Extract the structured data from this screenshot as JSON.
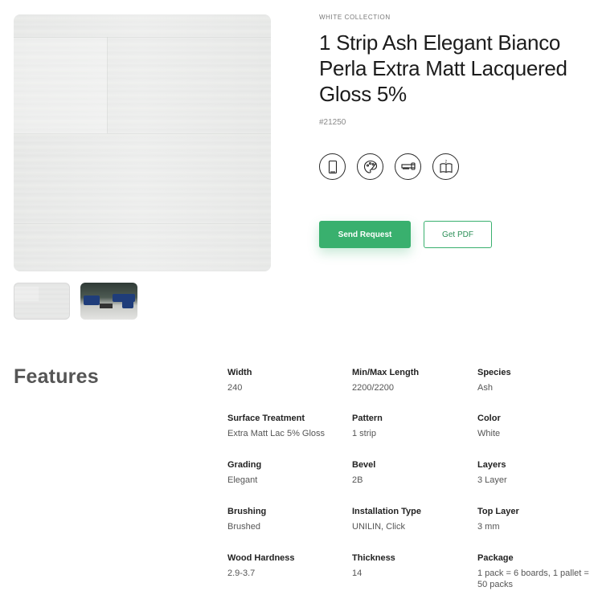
{
  "product": {
    "collection": "WHITE COLLECTION",
    "title": "1 Strip Ash Elegant Bianco Perla Extra Matt Lacquered Gloss 5%",
    "sku": "#21250"
  },
  "icons": [
    {
      "name": "door-icon"
    },
    {
      "name": "palette-icon"
    },
    {
      "name": "saw-icon"
    },
    {
      "name": "book-icon"
    }
  ],
  "actions": {
    "send_request": "Send Request",
    "get_pdf": "Get PDF"
  },
  "features": {
    "title": "Features",
    "items": [
      {
        "label": "Width",
        "value": "240"
      },
      {
        "label": "Min/Max Length",
        "value": "2200/2200"
      },
      {
        "label": "Species",
        "value": "Ash"
      },
      {
        "label": "Surface Treatment",
        "value": "Extra Matt Lac 5% Gloss"
      },
      {
        "label": "Pattern",
        "value": "1 strip"
      },
      {
        "label": "Color",
        "value": "White"
      },
      {
        "label": "Grading",
        "value": "Elegant"
      },
      {
        "label": "Bevel",
        "value": "2B"
      },
      {
        "label": "Layers",
        "value": "3 Layer"
      },
      {
        "label": "Brushing",
        "value": "Brushed"
      },
      {
        "label": "Installation Type",
        "value": "UNILIN, Click"
      },
      {
        "label": "Top Layer",
        "value": "3 mm"
      },
      {
        "label": "Wood Hardness",
        "value": "2.9-3.7"
      },
      {
        "label": "Thickness",
        "value": "14"
      },
      {
        "label": "Package",
        "value": "1 pack = 6 boards, 1 pallet = 50 packs"
      }
    ]
  },
  "colors": {
    "accent": "#39b06e",
    "text": "#1c1c1c"
  }
}
